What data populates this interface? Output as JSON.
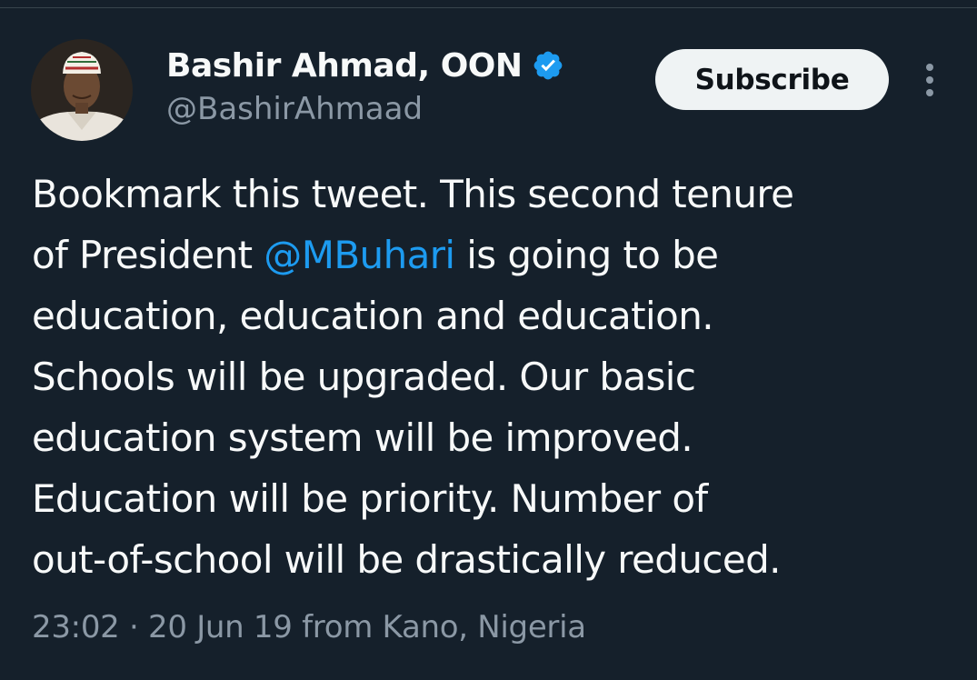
{
  "author": {
    "display_name": "Bashir Ahmad, OON",
    "handle": "@BashirAhmaad",
    "verified": true,
    "verified_color": "#1d9bf0",
    "avatar_icon": "profile-photo"
  },
  "actions": {
    "subscribe_label": "Subscribe",
    "more_icon": "vertical-ellipsis"
  },
  "tweet": {
    "lines": [
      {
        "before": "Bookmark this tweet. This second tenure",
        "mention": "",
        "after": ""
      },
      {
        "before": "of President ",
        "mention": "@MBuhari",
        "after": " is going to be"
      },
      {
        "before": "education, education and education.",
        "mention": "",
        "after": ""
      },
      {
        "before": "Schools will be upgraded. Our basic",
        "mention": "",
        "after": ""
      },
      {
        "before": "education system will be improved.",
        "mention": "",
        "after": ""
      },
      {
        "before": "Education will be priority. Number of",
        "mention": "",
        "after": ""
      },
      {
        "before": "out-of-school will be drastically reduced.",
        "mention": "",
        "after": ""
      }
    ],
    "time": "23:02",
    "separator": "·",
    "date": "20 Jun 19",
    "location": "from Kano, Nigeria"
  },
  "colors": {
    "background": "#15202b",
    "text": "#f7f9f9",
    "secondary_text": "#8b98a5",
    "link": "#1d9bf0"
  }
}
